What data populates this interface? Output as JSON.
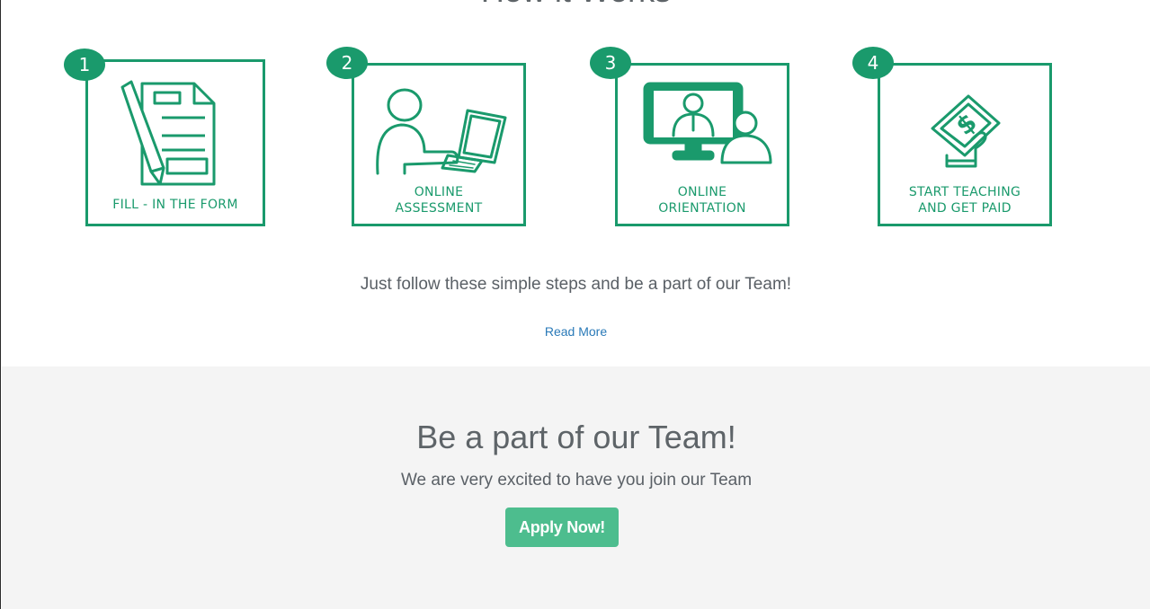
{
  "how_it_works": {
    "title": "How it Works",
    "steps": [
      {
        "number": "1",
        "caption": "FILL - IN THE FORM",
        "icon": "form-icon"
      },
      {
        "number": "2",
        "caption_line1": "ONLINE",
        "caption_line2": "ASSESSMENT",
        "icon": "laptop-user-icon"
      },
      {
        "number": "3",
        "caption_line1": "ONLINE",
        "caption_line2": "ORIENTATION",
        "icon": "video-call-icon"
      },
      {
        "number": "4",
        "caption_line1": "START TEACHING",
        "caption_line2": "AND GET PAID",
        "icon": "dollar-hand-icon"
      }
    ],
    "intro": "Just follow these simple steps and be a part of our Team!",
    "read_more": "Read More"
  },
  "cta": {
    "title": "Be a part of our Team!",
    "subtitle": "We are very excited to have you join our Team",
    "button": "Apply Now!"
  },
  "colors": {
    "accent": "#1a9a6c",
    "button": "#4dbd8e",
    "link": "#2a7ab8",
    "cta_bg": "#f4f4f4"
  }
}
